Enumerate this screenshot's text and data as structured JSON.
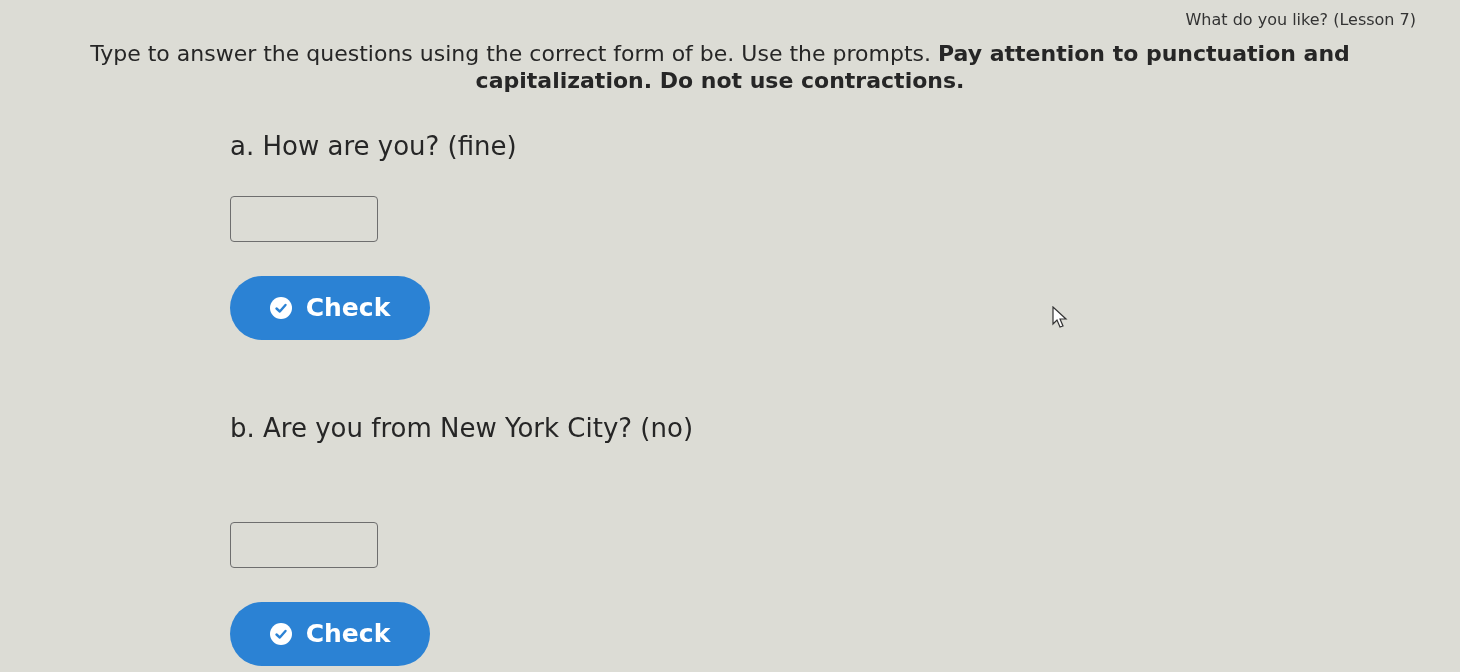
{
  "header": {
    "lesson_title": "What do you like? (Lesson 7)"
  },
  "instructions": "Type to answer the questions using the correct form of be. Use the prompts. **Pay attention to punctuation and capitalization. Do not use contractions.**",
  "questions": [
    {
      "prompt": "a. How are you? (fine)",
      "check_button": "Check"
    },
    {
      "prompt": "b. Are you from New York City? (no)",
      "check_button": "Check"
    }
  ]
}
